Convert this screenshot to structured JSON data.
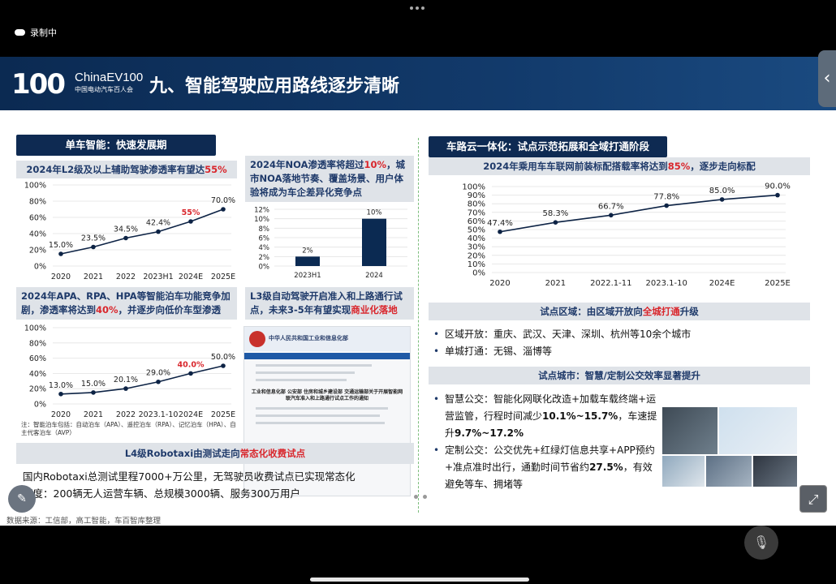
{
  "status": {
    "recording_label": "录制中"
  },
  "header": {
    "logo_mark": "100",
    "logo_name": "ChinaEV100",
    "logo_sub": "中国电动汽车百人会",
    "title": "九、智能驾驶应用路线逐步清晰"
  },
  "left": {
    "section_pill": "单车智能：快速发展期",
    "l2_title_pre": "2024年L2级及以上辅助驾驶渗透率有望达",
    "l2_title_hl": "55%",
    "noa_title_pre": "2024年NOA渗透率将超过",
    "noa_title_hl": "10%",
    "noa_title_post": "，城市NOA落地节奏、覆盖场景、用户体验将成为车企差异化竞争点",
    "apa_title_pre": "2024年APA、RPA、HPA等智能泊车功能竞争加剧，渗透率将达到",
    "apa_title_hl": "40%",
    "apa_title_post": "，并逐步向低价车型渗透",
    "l3_title_pre": "L3级自动驾驶开启准入和上路通行试点，未来3-5年有望实现",
    "l3_title_hl": "商业化落地",
    "apa_note": "注：智能泊车包括：自动泊车（APA）、遥控泊车（RPA）、记忆泊车（HPA）、自主代客泊车（AVP）",
    "l4_title_pre": "L4级Robotaxi由测试走向",
    "l4_title_hl": "常态化收费试点",
    "l4_line1": "国内Robotaxi总测试里程7000+万公里，无驾驶员收费试点已实现常态化",
    "l4_line2": "百度：200辆无人运营车辆、总规模3000辆、服务300万用户",
    "source": "数据来源：工信部，高工智能，车百智库整理",
    "doc_site_title": "中华人民共和国工业和信息化部",
    "doc_heading": "工业和信息化部 公安部 住房和城乡建设部 交通运输部关于开展智能网联汽车准入和上路通行试点工作的通知"
  },
  "right": {
    "section_pill": "车路云一体化：试点示范拓展和全域打通阶段",
    "v2x_title_pre": "2024年乘用车车联网前装标配搭载率将达到",
    "v2x_title_hl": "85%",
    "v2x_title_post": "，逐步走向标配",
    "area_title_pre": "试点区域：由区域开放向",
    "area_title_hl": "全城打通",
    "area_title_post": "升级",
    "area_b1": "区域开放：重庆、武汉、天津、深圳、杭州等10余个城市",
    "area_b2": "单城打通：无锡、淄博等",
    "city_title": "试点城市：智慧/定制公交效率显著提升",
    "bus_b1_a": "智慧公交：智能化网联化改造+加载车载终端+运营监管，行程时间减少",
    "bus_b1_hl": "10.1%~15.7%",
    "bus_b1_b": "，车速提升",
    "bus_b1_hl2": "9.7%~17.2%",
    "bus_b2_a": "定制公交：公交优先+红绿灯信息共享+APP预约+准点准时出行，通勤时间节省约",
    "bus_b2_hl": "27.5%",
    "bus_b2_b": "，有效避免等车、拥堵等"
  },
  "chart_data": [
    {
      "type": "line",
      "title": "2024年L2级及以上辅助驾驶渗透率有望达55%",
      "categories": [
        "2020",
        "2021",
        "2022",
        "2023H1",
        "2024E",
        "2025E"
      ],
      "values": [
        15.0,
        23.5,
        34.5,
        42.4,
        55,
        70.0
      ],
      "labels": [
        "15.0%",
        "23.5%",
        "34.5%",
        "42.4%",
        "55%",
        "70.0%"
      ],
      "highlight_index": 4,
      "yticks": [
        "0%",
        "20%",
        "40%",
        "60%",
        "80%",
        "100%"
      ],
      "ylim": [
        0,
        100
      ]
    },
    {
      "type": "bar",
      "title": "2024年NOA渗透率将超过10%",
      "categories": [
        "2023H1",
        "2024"
      ],
      "values": [
        2,
        10
      ],
      "labels": [
        "2%",
        "10%"
      ],
      "yticks": [
        "0%",
        "2%",
        "4%",
        "6%",
        "8%",
        "10%",
        "12%"
      ],
      "ylim": [
        0,
        12
      ]
    },
    {
      "type": "line",
      "title": "2024年APA、RPA、HPA等智能泊车渗透率将达到40%",
      "categories": [
        "2020",
        "2021",
        "2022",
        "2023.1-10",
        "2024E",
        "2025E"
      ],
      "values": [
        13.0,
        15.0,
        20.1,
        29.0,
        40.0,
        50.0
      ],
      "labels": [
        "13.0%",
        "15.0%",
        "20.1%",
        "29.0%",
        "40.0%",
        "50.0%"
      ],
      "highlight_index": 4,
      "yticks": [
        "0%",
        "20%",
        "40%",
        "60%",
        "80%",
        "100%"
      ],
      "ylim": [
        0,
        100
      ]
    },
    {
      "type": "line",
      "title": "2024年乘用车车联网前装标配搭载率将达到85%",
      "categories": [
        "2020",
        "2021",
        "2022.1-11",
        "2023.1-10",
        "2024E",
        "2025E"
      ],
      "values": [
        47.4,
        58.3,
        66.7,
        77.8,
        85.0,
        90.0
      ],
      "labels": [
        "47.4%",
        "58.3%",
        "66.7%",
        "77.8%",
        "85.0%",
        "90.0%"
      ],
      "yticks": [
        "0%",
        "10%",
        "20%",
        "30%",
        "40%",
        "50%",
        "60%",
        "70%",
        "80%",
        "90%",
        "100%"
      ],
      "ylim": [
        0,
        100
      ]
    }
  ],
  "colors": {
    "navy": "#0e2a52",
    "red": "#d9262c",
    "bar": "#0b2a52"
  },
  "icons": {
    "edit": "edit-icon",
    "expand": "expand-icon",
    "mic_off": "mic-off-icon",
    "back": "chevron-left-icon"
  }
}
